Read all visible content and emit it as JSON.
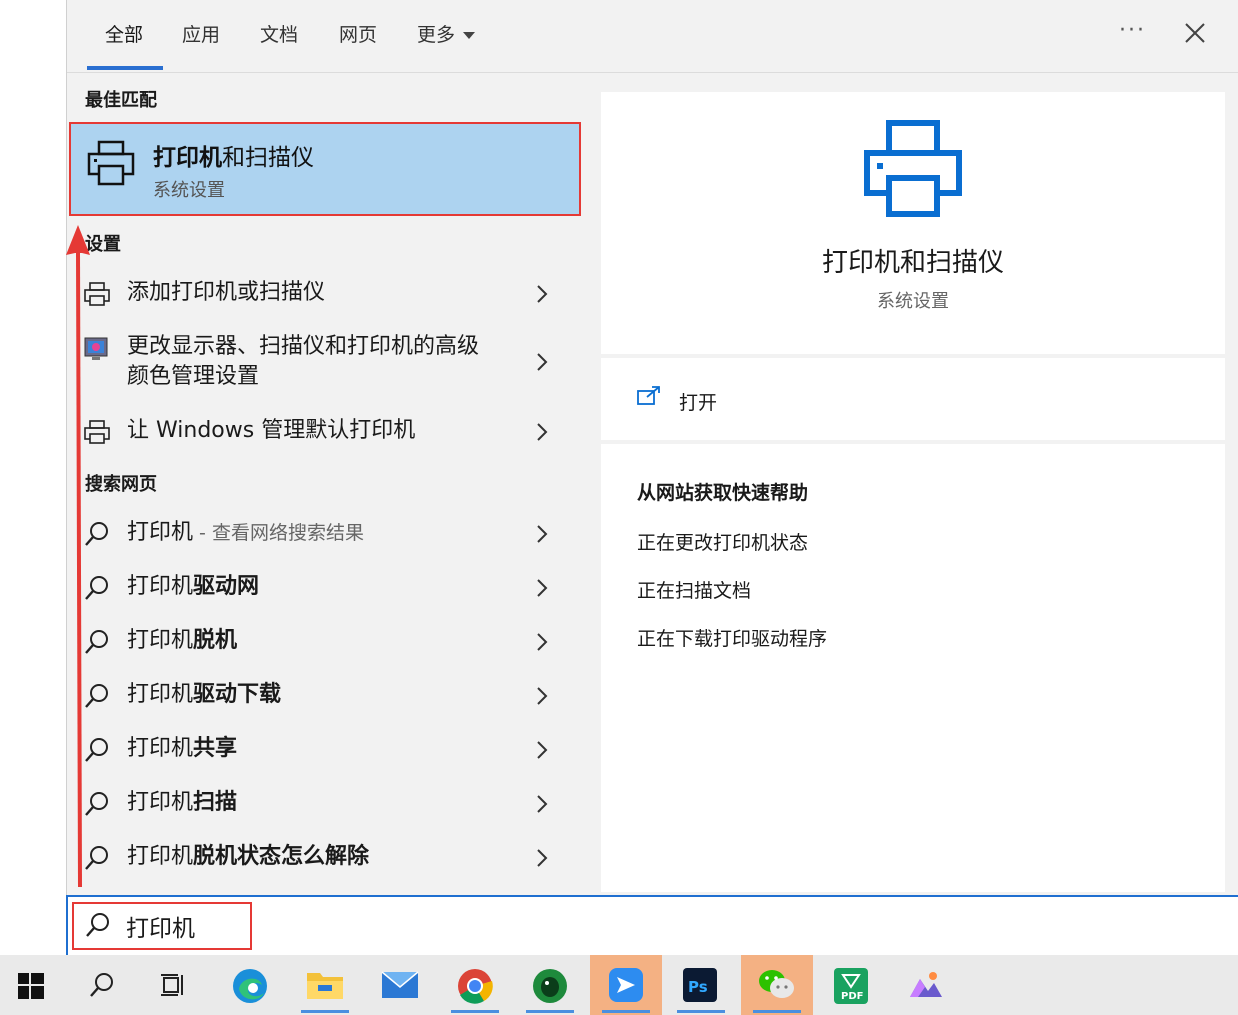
{
  "header": {
    "tabs": [
      {
        "label": "全部"
      },
      {
        "label": "应用"
      },
      {
        "label": "文档"
      },
      {
        "label": "网页"
      },
      {
        "label": "更多"
      }
    ],
    "more_options": "···"
  },
  "sections": {
    "best_match": "最佳匹配",
    "settings": "设置",
    "web": "搜索网页"
  },
  "best_match": {
    "title_bold": "打印机",
    "title_rest": "和扫描仪",
    "subtitle": "系统设置"
  },
  "settings_items": [
    {
      "label": "添加打印机或扫描仪"
    },
    {
      "label_line1": "更改显示器、扫描仪和打印机的高级",
      "label_line2": "颜色管理设置"
    },
    {
      "label": "让 Windows 管理默认打印机"
    }
  ],
  "web_items": [
    {
      "prefix": "打印机",
      "suffix": "",
      "hint": " - 查看网络搜索结果"
    },
    {
      "prefix": "打印机",
      "suffix": "驱动网"
    },
    {
      "prefix": "打印机",
      "suffix": "脱机"
    },
    {
      "prefix": "打印机",
      "suffix": "驱动下载"
    },
    {
      "prefix": "打印机",
      "suffix": "共享"
    },
    {
      "prefix": "打印机",
      "suffix": "扫描"
    },
    {
      "prefix": "打印机",
      "suffix": "脱机状态怎么解除"
    }
  ],
  "preview": {
    "title": "打印机和扫描仪",
    "subtitle": "系统设置",
    "open_label": "打开",
    "help_title": "从网站获取快速帮助",
    "help_links": [
      "正在更改打印机状态",
      "正在扫描文档",
      "正在下载打印驱动程序"
    ]
  },
  "search": {
    "value": "打印机"
  },
  "taskbar": {
    "items": [
      "windows-start",
      "search",
      "task-view",
      "edge",
      "file-explorer",
      "mail",
      "chrome",
      "evernote",
      "feishu",
      "photoshop",
      "wechat",
      "pdf",
      "photos"
    ],
    "highlight_color": "#f4b183"
  },
  "colors": {
    "accent": "#1f6fd0",
    "best_match_bg": "#add3f0",
    "annotation_red": "#e53935"
  }
}
